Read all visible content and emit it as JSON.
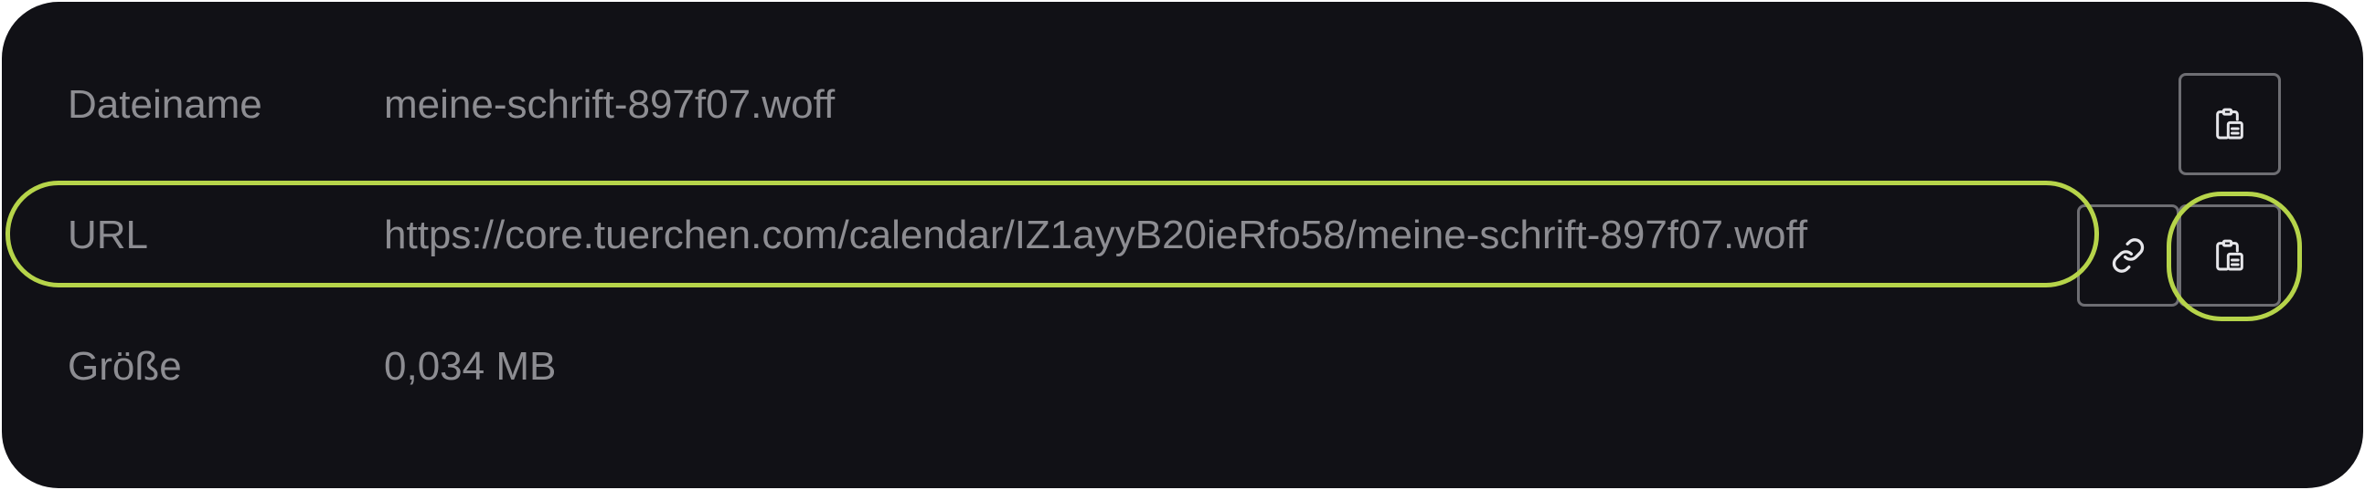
{
  "rows": [
    {
      "label": "Dateiname",
      "value": "meine-schrift-897f07.woff"
    },
    {
      "label": "URL",
      "value": "https://core.tuerchen.com/calendar/IZ1ayyB20ieRfo58/meine-schrift-897f07.woff"
    },
    {
      "label": "Größe",
      "value": "0,034 MB"
    }
  ],
  "icons": {
    "copy": "clipboard-copy-icon",
    "link": "link-icon"
  },
  "colors": {
    "background": "#111116",
    "text": "#8d8d92",
    "button_border": "#6e6e73",
    "highlight": "#b6d44a"
  }
}
